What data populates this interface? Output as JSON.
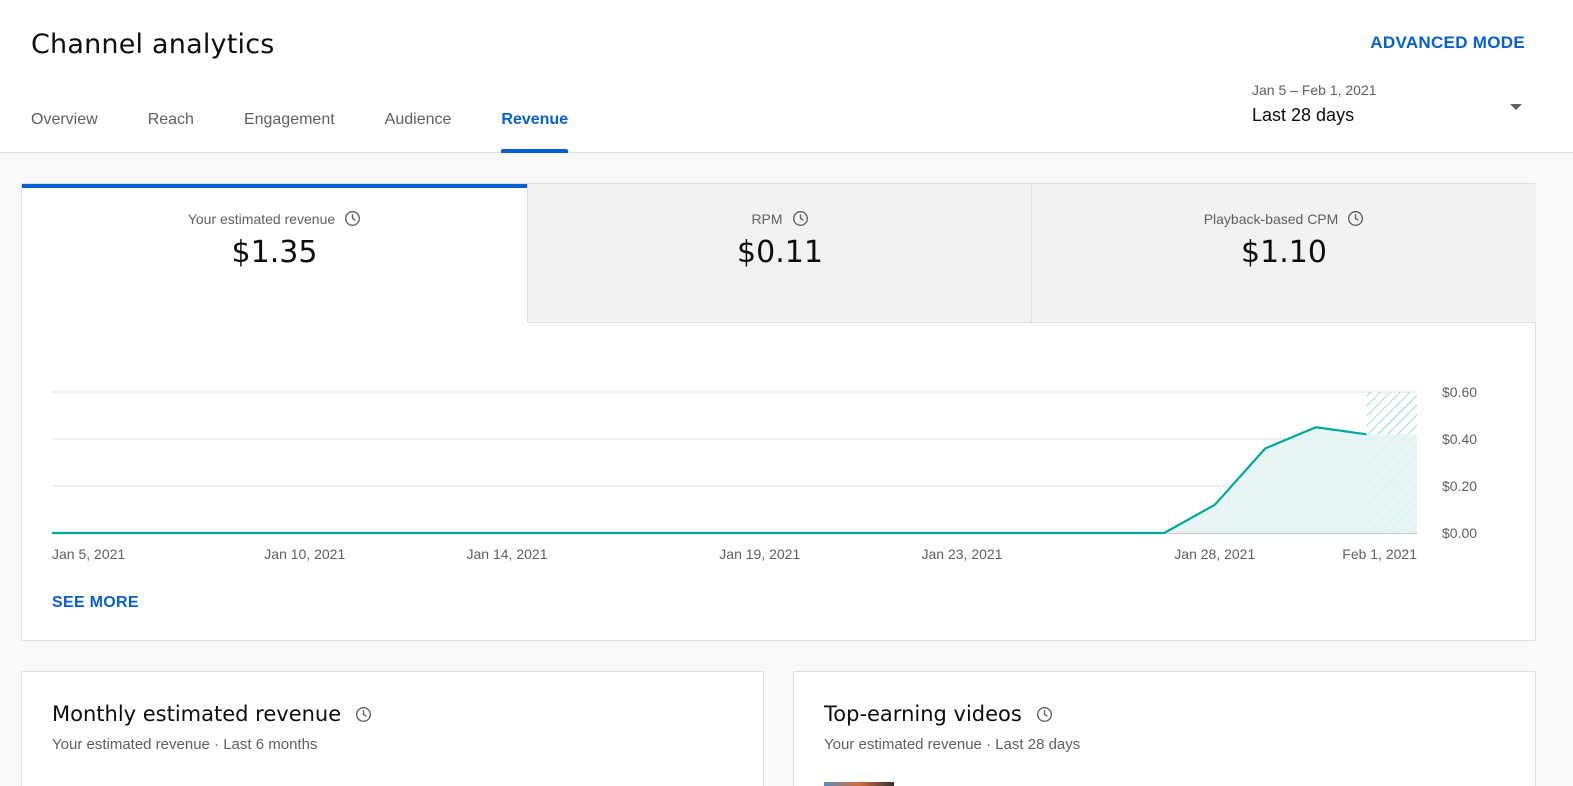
{
  "header": {
    "title": "Channel analytics",
    "advanced_mode": "ADVANCED MODE",
    "tabs": [
      {
        "label": "Overview"
      },
      {
        "label": "Reach"
      },
      {
        "label": "Engagement"
      },
      {
        "label": "Audience"
      },
      {
        "label": "Revenue",
        "active": true
      }
    ],
    "date_picker": {
      "range": "Jan 5 – Feb 1, 2021",
      "label": "Last 28 days"
    }
  },
  "metrics": [
    {
      "label": "Your estimated revenue",
      "value": "$1.35",
      "selected": true,
      "icon": "clock-icon"
    },
    {
      "label": "RPM",
      "value": "$0.11",
      "icon": "clock-icon"
    },
    {
      "label": "Playback-based CPM",
      "value": "$1.10",
      "icon": "clock-icon"
    }
  ],
  "see_more": "SEE MORE",
  "chart_data": {
    "type": "area",
    "title": "",
    "xlabel": "",
    "ylabel": "",
    "x": [
      "Jan 5",
      "Jan 6",
      "Jan 7",
      "Jan 8",
      "Jan 9",
      "Jan 10",
      "Jan 11",
      "Jan 12",
      "Jan 13",
      "Jan 14",
      "Jan 15",
      "Jan 16",
      "Jan 17",
      "Jan 18",
      "Jan 19",
      "Jan 20",
      "Jan 21",
      "Jan 22",
      "Jan 23",
      "Jan 24",
      "Jan 25",
      "Jan 26",
      "Jan 27",
      "Jan 28",
      "Jan 29",
      "Jan 30",
      "Jan 31",
      "Feb 1"
    ],
    "series": [
      {
        "values": [
          0,
          0,
          0,
          0,
          0,
          0,
          0,
          0,
          0,
          0,
          0,
          0,
          0,
          0,
          0,
          0,
          0,
          0,
          0,
          0,
          0,
          0,
          0,
          0.12,
          0.36,
          0.45,
          0.42,
          0.42
        ]
      }
    ],
    "x_tick_labels": [
      "Jan 5, 2021",
      "Jan 10, 2021",
      "Jan 14, 2021",
      "Jan 19, 2021",
      "Jan 23, 2021",
      "Jan 28, 2021",
      "Feb 1, 2021"
    ],
    "x_tick_days": [
      "Jan 5",
      "Jan 10",
      "Jan 14",
      "Jan 19",
      "Jan 23",
      "Jan 28",
      "Feb 1"
    ],
    "y_tick_labels": [
      "$0.00",
      "$0.20",
      "$0.40",
      "$0.60"
    ],
    "y_ticks": [
      0,
      0.2,
      0.4,
      0.6
    ],
    "ylim": [
      0,
      0.6
    ],
    "y_axis_side": "right",
    "grid": true,
    "incomplete_period_start": "Jan 31",
    "line_color": "#00a89c",
    "fill_color": "#e3f5f3"
  },
  "panels": [
    {
      "title": "Monthly estimated revenue",
      "subtitle": "Your estimated revenue · Last 6 months"
    },
    {
      "title": "Top-earning videos",
      "subtitle": "Your estimated revenue · Last 28 days"
    }
  ],
  "colors": {
    "accent": "#065fd4",
    "chart_line": "#00a89c"
  }
}
